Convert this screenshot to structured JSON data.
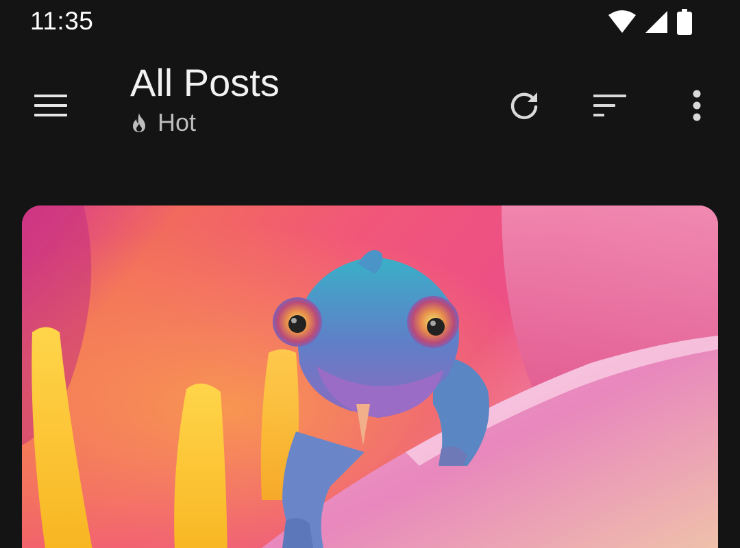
{
  "status_bar": {
    "time": "11:35",
    "icons": [
      "wifi-icon",
      "cellular-signal-icon",
      "battery-icon"
    ]
  },
  "app_bar": {
    "title": "All Posts",
    "subtitle": "Hot",
    "subtitle_icon": "flame-icon",
    "navigation_icon": "hamburger-menu-icon",
    "actions": [
      "refresh-icon",
      "sort-icon",
      "more-vertical-icon"
    ]
  },
  "feed": {
    "posts": [
      {
        "media": "chameleon-on-flower-photo"
      }
    ]
  },
  "colors": {
    "background": "#141414",
    "title": "#f2f2f2",
    "subtitle": "#bdbdbd",
    "icon": "#d9d9d9"
  }
}
